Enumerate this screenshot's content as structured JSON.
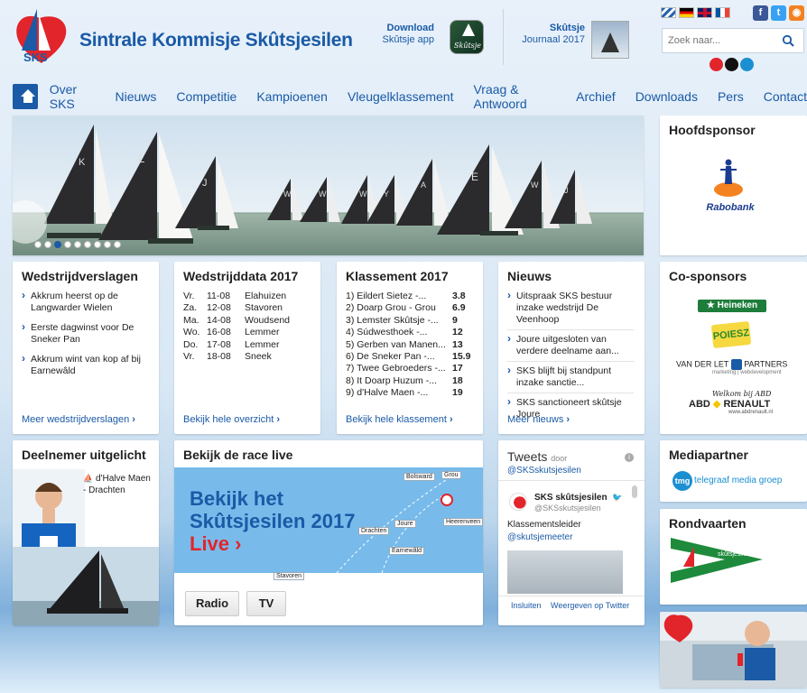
{
  "header": {
    "site_title": "Sintrale Kommisje Skûtsjesilen",
    "logo_text": "SKS",
    "download_title": "Download",
    "download_sub": "Skûtsje app",
    "app_icon_text": "Skûtsje",
    "journaal_title": "Skûtsje",
    "journaal_sub": "Journaal 2017",
    "search_placeholder": "Zoek naar..."
  },
  "nav": {
    "items": [
      "Over SKS",
      "Nieuws",
      "Competitie",
      "Kampioenen",
      "Vleugelklassement",
      "Vraag & Antwoord",
      "Archief",
      "Downloads",
      "Pers",
      "Contact"
    ]
  },
  "hero": {
    "sail_letters": [
      "K",
      "L",
      "J",
      "W",
      "W",
      "W",
      "Y",
      "A",
      "E",
      "W",
      "J"
    ]
  },
  "wedstrijdverslagen": {
    "title": "Wedstrijdverslagen",
    "items": [
      "Akkrum heerst op de Langwarder Wielen",
      "Eerste dagwinst voor De Sneker Pan",
      "Akkrum wint van kop af bij Earnewâld"
    ],
    "more": "Meer wedstrijdverslagen"
  },
  "wedstrijddata": {
    "title": "Wedstrijddata 2017",
    "rows": [
      [
        "Vr.",
        "11-08",
        "Elahuizen"
      ],
      [
        "Za.",
        "12-08",
        "Stavoren"
      ],
      [
        "Ma.",
        "14-08",
        "Woudsend"
      ],
      [
        "Wo.",
        "16-08",
        "Lemmer"
      ],
      [
        "Do.",
        "17-08",
        "Lemmer"
      ],
      [
        "Vr.",
        "18-08",
        "Sneek"
      ]
    ],
    "more": "Bekijk hele overzicht"
  },
  "klassement": {
    "title": "Klassement 2017",
    "rows": [
      [
        "1) Eildert Sietez -...",
        "3.8"
      ],
      [
        "2) Doarp Grou - Grou",
        "6.9"
      ],
      [
        "3) Lemster Skûtsje -...",
        "9"
      ],
      [
        "4) Súdwesthoek -...",
        "12"
      ],
      [
        "5) Gerben van Manen...",
        "13"
      ],
      [
        "6) De Sneker Pan -...",
        "15.9"
      ],
      [
        "7) Twee Gebroeders -...",
        "17"
      ],
      [
        "8) It Doarp Huzum -...",
        "18"
      ],
      [
        "9) d'Halve Maen -...",
        "19"
      ]
    ],
    "more": "Bekijk hele klassement"
  },
  "nieuws": {
    "title": "Nieuws",
    "items": [
      "Uitspraak SKS bestuur inzake wedstrijd De Veenhoop",
      "Joure uitgesloten van verdere deelname aan...",
      "SKS blijft bij standpunt inzake sanctie...",
      "SKS sanctioneert skûtsje Joure"
    ],
    "more": "Meer nieuws"
  },
  "hoofdsponsor": {
    "title": "Hoofdsponsor",
    "name": "Rabobank"
  },
  "cosponsors": {
    "title": "Co-sponsors",
    "heineken": "Heineken",
    "poiesz": "POIESZ",
    "vanderlet": "VAN DER LET",
    "partners": "PARTNERS",
    "vanderlet_sub": "marketing | webdevelopment",
    "abd_welkom": "Welkom bij ABD",
    "abd_name": "ABD",
    "renault": "RENAULT",
    "abd_url": "www.abdrenault.nl"
  },
  "deelnemer": {
    "title": "Deelnemer uitgelicht",
    "boat": "d'Halve Maen - Drachten"
  },
  "race": {
    "title": "Bekijk de race live",
    "line1": "Bekijk het",
    "line2": "Skûtsjesilen 2017",
    "live": "Live",
    "map_labels": [
      "Grou",
      "Bolsward",
      "Joure",
      "Heerenveen",
      "Drachten",
      "Earnewâld",
      "Stavoren"
    ],
    "btn_radio": "Radio",
    "btn_tv": "TV"
  },
  "tweets": {
    "title": "Tweets",
    "by": "door",
    "handle": "@SKSskutsjesilen",
    "author": "SKS skûtsjesilen",
    "author_handle": "@SKSskutsjesilen",
    "text": "Klassementsleider",
    "mention": "@skutsjemeeter",
    "embed": "Insluiten",
    "view": "Weergeven op Twitter"
  },
  "mediapartner": {
    "title": "Mediapartner",
    "logo": "tmg",
    "name": "telegraaf media groep"
  },
  "rondvaarten": {
    "title": "Rondvaarten",
    "flag_text": "skûtsjesilen"
  },
  "colors": {
    "brand_blue": "#1a5aa6",
    "brand_red": "#e2242b"
  }
}
